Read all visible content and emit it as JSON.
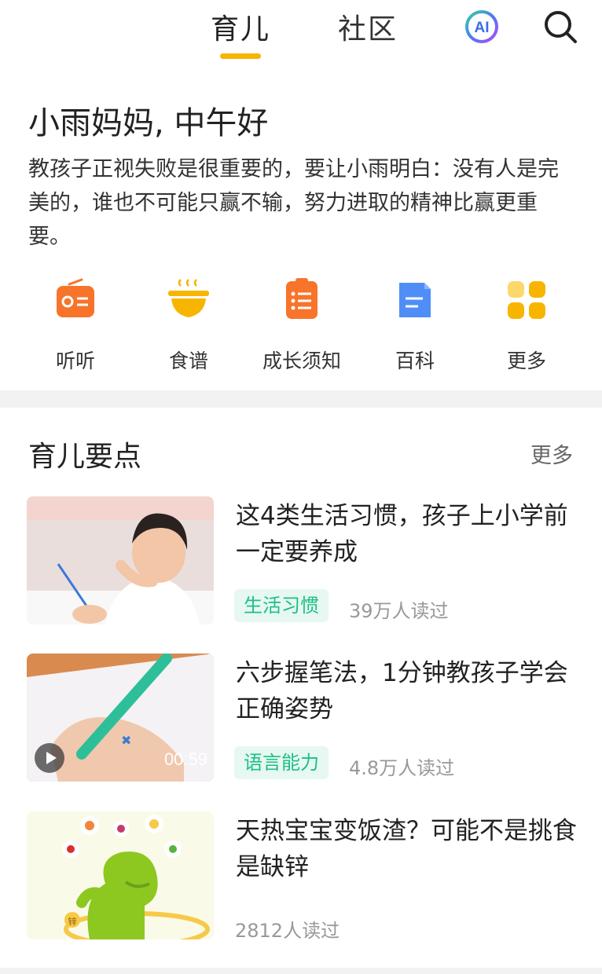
{
  "header": {
    "tabs": [
      {
        "label": "育儿",
        "active": true
      },
      {
        "label": "社区",
        "active": false
      }
    ],
    "ai_label": "AI",
    "accent": "#F7B500"
  },
  "greeting": {
    "title": "小雨妈妈, 中午好",
    "message": "教孩子正视失败是很重要的，要让小雨明白：没有人是完美的，谁也不可能只赢不输，努力进取的精神比赢更重要。"
  },
  "quick_links": [
    {
      "label": "听听",
      "icon": "radio-icon",
      "color": "#F7742A"
    },
    {
      "label": "食谱",
      "icon": "bowl-icon",
      "color": "#F7B500"
    },
    {
      "label": "成长须知",
      "icon": "clipboard-icon",
      "color": "#F7742A"
    },
    {
      "label": "百科",
      "icon": "book-icon",
      "color": "#4F8EF7"
    },
    {
      "label": "更多",
      "icon": "grid-icon",
      "color": "#F7B500"
    }
  ],
  "section": {
    "title": "育儿要点",
    "more_label": "更多"
  },
  "articles": [
    {
      "title": "这4类生活习惯，孩子上小学前一定要养成",
      "tag": "生活习惯",
      "reads": "39万人读过"
    },
    {
      "title": "六步握笔法，1分钟教孩子学会正确姿势",
      "tag": "语言能力",
      "reads": "4.8万人读过",
      "duration": "00:59"
    },
    {
      "title": "天热宝宝变饭渣？可能不是挑食是缺锌",
      "reads": "2812人读过",
      "thumb_text": "锌"
    }
  ],
  "colors": {
    "tag_text": "#1dbf86",
    "tag_bg": "#e6f8f1"
  }
}
